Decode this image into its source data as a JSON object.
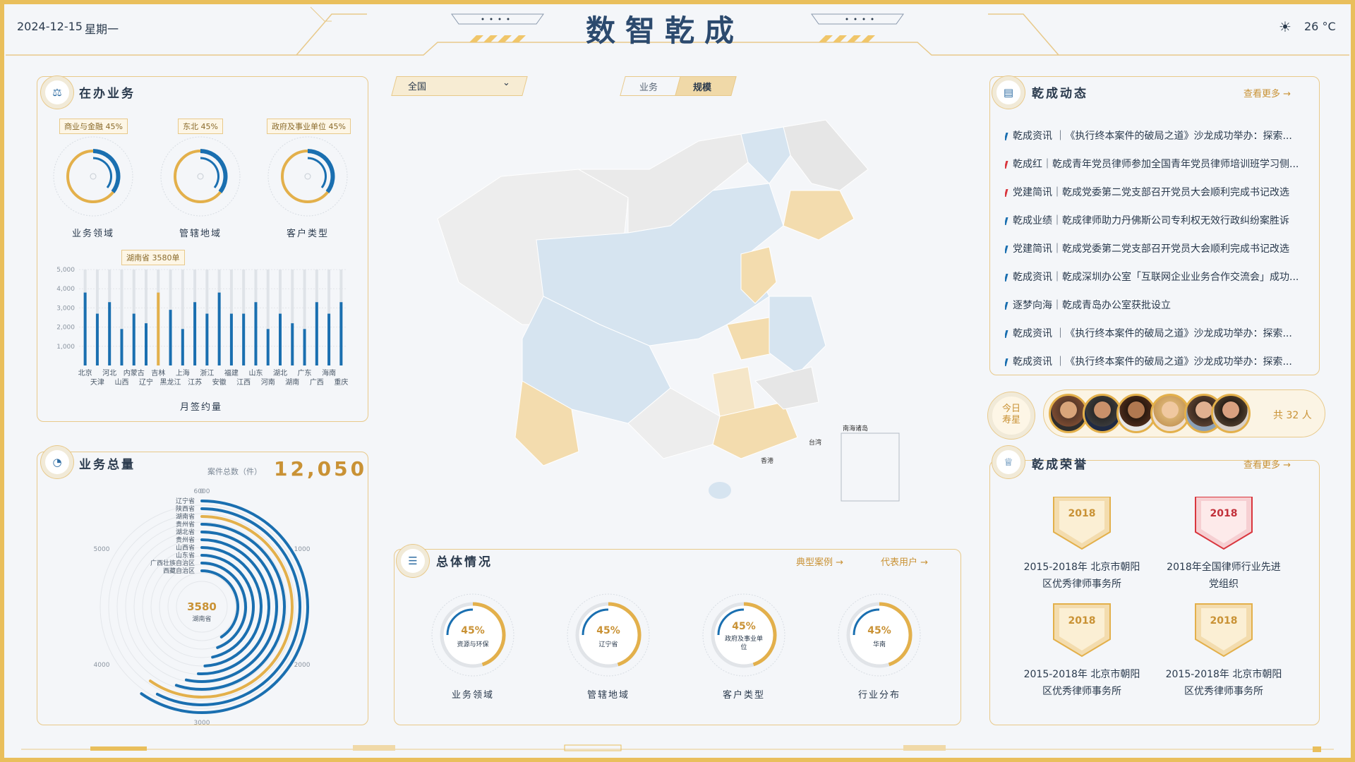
{
  "header": {
    "date": "2024-12-15",
    "weekday": "星期一",
    "title": "数智乾成",
    "weather_icon": "sun-icon",
    "temperature": "26 °C"
  },
  "colors": {
    "accent": "#c99235",
    "blue": "#1a6fb0",
    "gold": "#e3b04b",
    "border": "#e8c98a"
  },
  "panel_left_top": {
    "title": "在办业务",
    "donuts": [
      {
        "tag": "商业与金融 45%",
        "label": "业务领域"
      },
      {
        "tag": "东北 45%",
        "label": "管辖地域"
      },
      {
        "tag": "政府及事业单位 45%",
        "label": "客户类型"
      }
    ],
    "bar_tooltip": "湖南省 3580单",
    "bar_xlabel": "月签约量"
  },
  "panel_left_bottom": {
    "title": "业务总量",
    "total_label": "案件总数（件）",
    "total_value": "12,050",
    "center_value": "3580",
    "center_label": "湖南省"
  },
  "map": {
    "region_select": "全国",
    "toggle": [
      "业务",
      "规模"
    ],
    "labels": {
      "south_sea": "南海诸岛",
      "taiwan": "台湾",
      "hongkong": "香港"
    }
  },
  "panel_center": {
    "title": "总体情况",
    "link1": "典型案例",
    "link2": "代表用户",
    "gauges": [
      {
        "pct": "45%",
        "sub": "资源与环保",
        "label": "业务领域",
        "value": 0.45
      },
      {
        "pct": "45%",
        "sub": "辽宁省",
        "label": "管辖地域",
        "value": 0.45
      },
      {
        "pct": "45%",
        "sub": "政府及事业单位",
        "label": "客户类型",
        "value": 0.45
      },
      {
        "pct": "45%",
        "sub": "华南",
        "label": "行业分布",
        "value": 0.45
      }
    ]
  },
  "panel_right_top": {
    "title": "乾成动态",
    "more": "查看更多",
    "news": [
      {
        "text": "乾成资讯 ｜《执行终本案件的破局之道》沙龙成功举办：探索...",
        "color": "#1a6fb0"
      },
      {
        "text": "乾成红｜乾成青年党员律师参加全国青年党员律师培训班学习侧...",
        "color": "#d9363e"
      },
      {
        "text": "党建简讯｜乾成党委第二党支部召开党员大会顺利完成书记改选",
        "color": "#d9363e"
      },
      {
        "text": "乾成业绩｜乾成律师助力丹佛斯公司专利权无效行政纠纷案胜诉",
        "color": "#1a6fb0"
      },
      {
        "text": "党建简讯｜乾成党委第二党支部召开党员大会顺利完成书记改选",
        "color": "#1a6fb0"
      },
      {
        "text": "乾成资讯｜乾成深圳办公室「互联网企业业务合作交流会」成功...",
        "color": "#1a6fb0"
      },
      {
        "text": "逐梦向海｜乾成青岛办公室获批设立",
        "color": "#1a6fb0"
      },
      {
        "text": "乾成资讯 ｜《执行终本案件的破局之道》沙龙成功举办：探索...",
        "color": "#1a6fb0"
      },
      {
        "text": "乾成资讯 ｜《执行终本案件的破局之道》沙龙成功举办：探索...",
        "color": "#1a6fb0"
      }
    ]
  },
  "birthday": {
    "badge_line1": "今日",
    "badge_line2": "寿星",
    "count": "共 32 人"
  },
  "panel_right_bottom": {
    "title": "乾成荣誉",
    "more": "查看更多",
    "honors": [
      {
        "year": "2018",
        "line1": "2015-2018年 北京市朝阳",
        "line2": "区优秀律师事务所",
        "style": "gold"
      },
      {
        "year": "2018",
        "line1": "2018年全国律师行业先进",
        "line2": "党组织",
        "style": "red"
      },
      {
        "year": "2018",
        "line1": "2015-2018年 北京市朝阳",
        "line2": "区优秀律师事务所",
        "style": "gold"
      },
      {
        "year": "2018",
        "line1": "2015-2018年 北京市朝阳",
        "line2": "区优秀律师事务所",
        "style": "gold"
      }
    ]
  },
  "chart_data": [
    {
      "type": "bar",
      "title": "",
      "xlabel": "月签约量",
      "ylabel": "",
      "ylim": [
        0,
        5000
      ],
      "yticks": [
        "5,000",
        "4,000",
        "3,000",
        "2,000",
        "1,000"
      ],
      "categories": [
        "北京",
        "天津",
        "河北",
        "山西",
        "内蒙古",
        "辽宁",
        "吉林",
        "黑龙江",
        "上海",
        "江苏",
        "浙江",
        "安徽",
        "福建",
        "江西",
        "山东",
        "河南",
        "湖北",
        "湖南",
        "广东",
        "广西",
        "海南",
        "重庆"
      ],
      "values": [
        3800,
        2700,
        3300,
        1900,
        2700,
        2200,
        3800,
        2900,
        1900,
        3300,
        2700,
        3800,
        2700,
        2700,
        3300,
        1900,
        2700,
        2200,
        1900,
        3300,
        2700,
        3300
      ],
      "highlight": "吉林"
    },
    {
      "type": "bar",
      "title": "",
      "categories": [
        "辽宁省",
        "陕西省",
        "湖南省",
        "贵州省",
        "湖北省",
        "贵州省",
        "山西省",
        "山东省",
        "广西壮族自治区",
        "西藏自治区"
      ],
      "ticks": [
        "0",
        "1000",
        "2000",
        "3000",
        "4000",
        "5000",
        "6000"
      ],
      "values": [
        3580,
        3450,
        3580,
        3300,
        3200,
        3050,
        2950,
        2800,
        2650,
        2450
      ],
      "highlight": "湖南省"
    },
    {
      "type": "pie",
      "categories": [
        "业务领域",
        "管辖地域",
        "客户类型"
      ],
      "values": [
        0.45,
        0.45,
        0.45
      ]
    }
  ]
}
